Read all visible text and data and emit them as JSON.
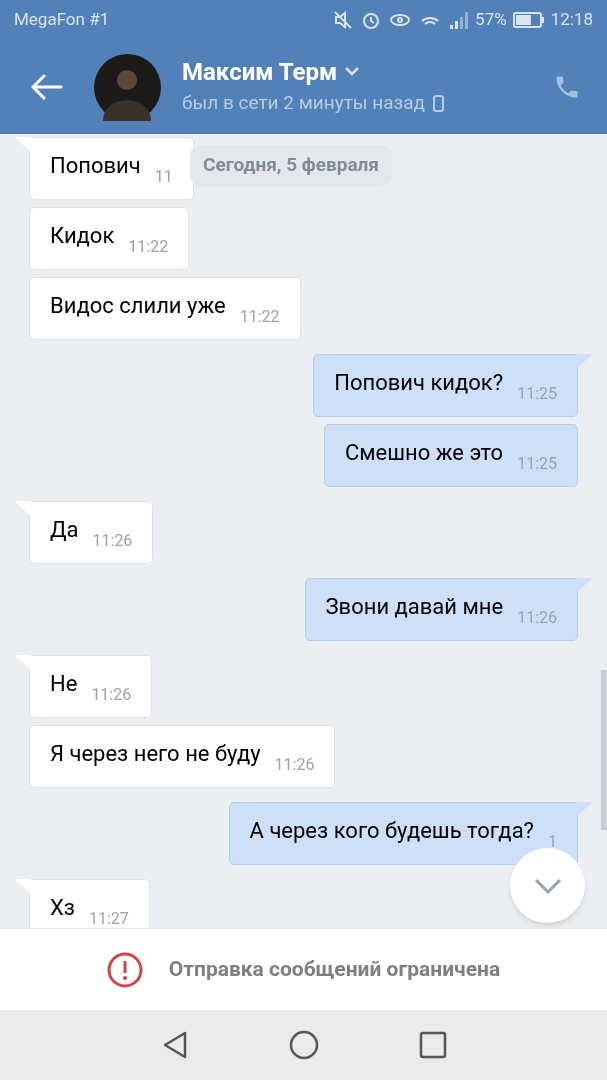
{
  "status_bar": {
    "carrier": "MegaFon #1",
    "battery": "57%",
    "time": "12:18"
  },
  "header": {
    "name": "Максим Терм",
    "last_seen": "был в сети 2 минуты назад"
  },
  "date_divider": "Сегодня, 5 февраля",
  "messages": [
    {
      "kind": "incoming",
      "text": "Попович",
      "time": "11",
      "tail": true
    },
    {
      "kind": "incoming",
      "text": "Кидок",
      "time": "11:22",
      "tail": false
    },
    {
      "kind": "incoming",
      "text": "Видос слили уже",
      "time": "11:22",
      "tail": false
    },
    {
      "kind": "outgoing",
      "text": "Попович кидок?",
      "time": "11:25",
      "tail": true
    },
    {
      "kind": "outgoing",
      "text": "Смешно же это",
      "time": "11:25",
      "tail": false
    },
    {
      "kind": "incoming",
      "text": "Да",
      "time": "11:26",
      "tail": true
    },
    {
      "kind": "outgoing",
      "text": "Звони давай мне",
      "time": "11:26",
      "tail": true
    },
    {
      "kind": "incoming",
      "text": "Не",
      "time": "11:26",
      "tail": true
    },
    {
      "kind": "incoming",
      "text": "Я через него не буду",
      "time": "11:26",
      "tail": false
    },
    {
      "kind": "outgoing",
      "text": "А через кого будешь тогда?",
      "time": "1",
      "tail": true
    },
    {
      "kind": "incoming",
      "text": "Хз",
      "time": "11:27",
      "tail": true
    }
  ],
  "notice": "Отправка сообщений ограничена"
}
